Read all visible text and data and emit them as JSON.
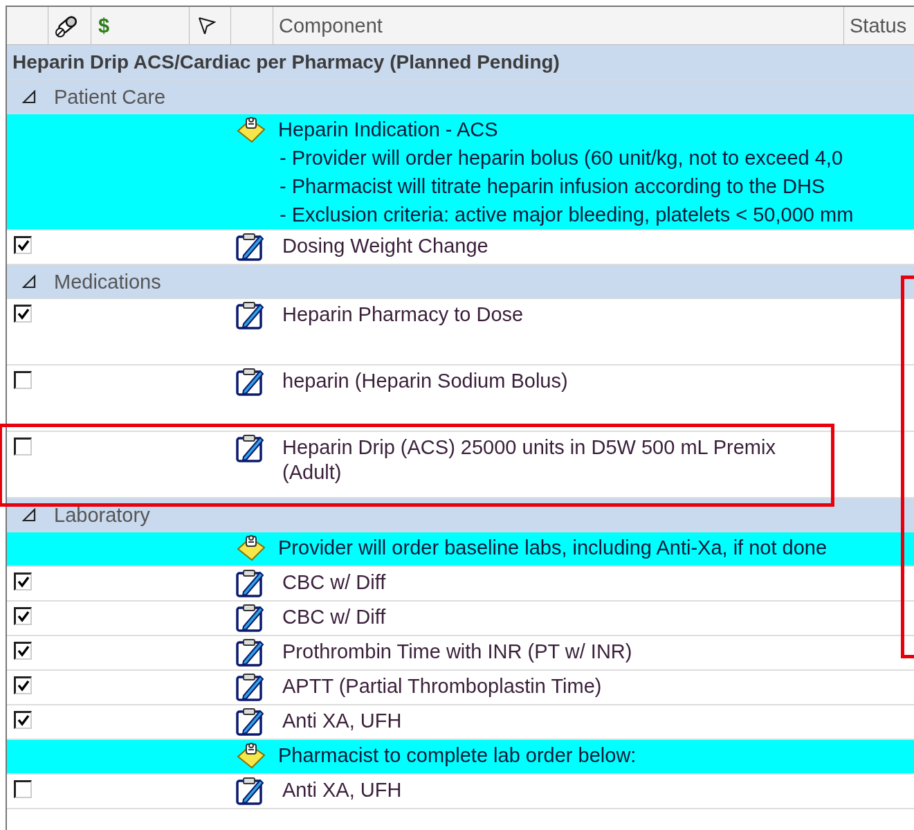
{
  "header": {
    "cost_label": "$",
    "component": "Component",
    "status": "Status"
  },
  "plan": {
    "title": "Heparin Drip ACS/Cardiac per Pharmacy (Planned Pending)"
  },
  "sections": [
    {
      "name": "Patient Care",
      "kind": "standard",
      "expanded": true,
      "rows": [
        {
          "kind": "note",
          "lines": [
            "Heparin Indication - ACS",
            "- Provider will order heparin bolus (60 unit/kg, not to exceed 4,0",
            "- Pharmacist will titrate heparin infusion according to the DHS",
            "- Exclusion criteria: active major bleeding, platelets < 50,000 mm"
          ]
        },
        {
          "kind": "order",
          "checked": true,
          "highlighted": false,
          "lines": [
            "Dosing Weight Change"
          ]
        }
      ]
    },
    {
      "name": "Medications",
      "kind": "medication",
      "expanded": true,
      "rows": [
        {
          "kind": "order",
          "checked": true,
          "highlighted": false,
          "lines": [
            "Heparin Pharmacy to Dose"
          ]
        },
        {
          "kind": "order",
          "checked": false,
          "highlighted": false,
          "lines": [
            "heparin (Heparin Sodium Bolus)"
          ]
        },
        {
          "kind": "order",
          "checked": false,
          "highlighted": true,
          "lines": [
            "Heparin Drip (ACS) 25000 units in D5W 500 mL Premix",
            "(Adult)"
          ]
        }
      ]
    },
    {
      "name": "Laboratory",
      "kind": "standard",
      "expanded": true,
      "rows": [
        {
          "kind": "note",
          "lines": [
            "Provider will order baseline labs, including Anti-Xa, if not done"
          ]
        },
        {
          "kind": "order",
          "checked": true,
          "highlighted": false,
          "lines": [
            "CBC w/ Diff"
          ]
        },
        {
          "kind": "order",
          "checked": true,
          "highlighted": false,
          "lines": [
            "CBC w/ Diff"
          ]
        },
        {
          "kind": "order",
          "checked": true,
          "highlighted": false,
          "lines": [
            "Prothrombin Time with INR (PT w/ INR)"
          ]
        },
        {
          "kind": "order",
          "checked": true,
          "highlighted": false,
          "lines": [
            "APTT (Partial Thromboplastin Time)"
          ]
        },
        {
          "kind": "order",
          "checked": true,
          "highlighted": false,
          "lines": [
            "Anti XA, UFH"
          ]
        },
        {
          "kind": "note",
          "lines": [
            "Pharmacist to complete lab order below:"
          ]
        },
        {
          "kind": "order",
          "checked": false,
          "highlighted": false,
          "lines": [
            "Anti XA, UFH"
          ]
        }
      ]
    }
  ]
}
